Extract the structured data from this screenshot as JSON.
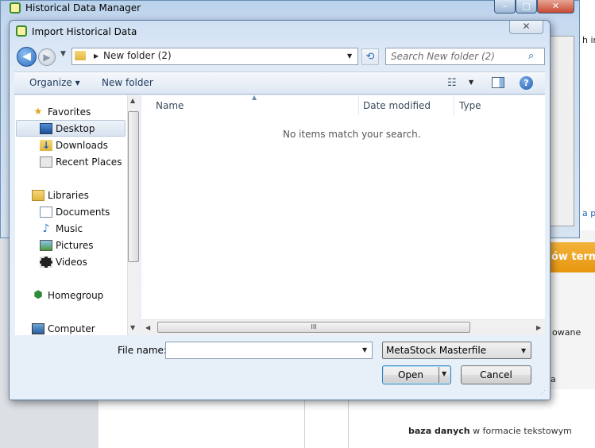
{
  "background": {
    "side_text_1": "h int",
    "side_text_2": "a pli",
    "banner": "ów termi",
    "side_text_3": "owane",
    "side_text_4": "a",
    "footer_bold": "baza danych",
    "footer_rest": "w formacie tekstowym"
  },
  "hdm_window": {
    "title": "Historical Data Manager",
    "minimize": "–",
    "maximize": "□",
    "close": "✕"
  },
  "dialog": {
    "title": "Import Historical Data",
    "close_glyph": "✕",
    "address": {
      "arrow_glyph": "▶",
      "path": "New folder (2)",
      "dropdown_glyph": "▼"
    },
    "search": {
      "placeholder": "Search New folder (2)",
      "icon": "search-icon"
    },
    "toolbar": {
      "organize": "Organize ▾",
      "new_folder": "New folder"
    },
    "nav": {
      "favorites": "Favorites",
      "desktop": "Desktop",
      "downloads": "Downloads",
      "recent": "Recent Places",
      "libraries": "Libraries",
      "documents": "Documents",
      "music": "Music",
      "pictures": "Pictures",
      "videos": "Videos",
      "homegroup": "Homegroup",
      "computer": "Computer"
    },
    "columns": {
      "name": "Name",
      "date_modified": "Date modified",
      "type": "Type"
    },
    "empty_message": "No items match your search.",
    "filename_label": "File name:",
    "filename_value": "",
    "filetype_selected": "MetaStock Masterfile",
    "open_button": "Open",
    "cancel_button": "Cancel"
  },
  "colors": {
    "accent": "#2a6bc1",
    "banner": "#e8960f",
    "window_frame": "#b9d1ea"
  }
}
